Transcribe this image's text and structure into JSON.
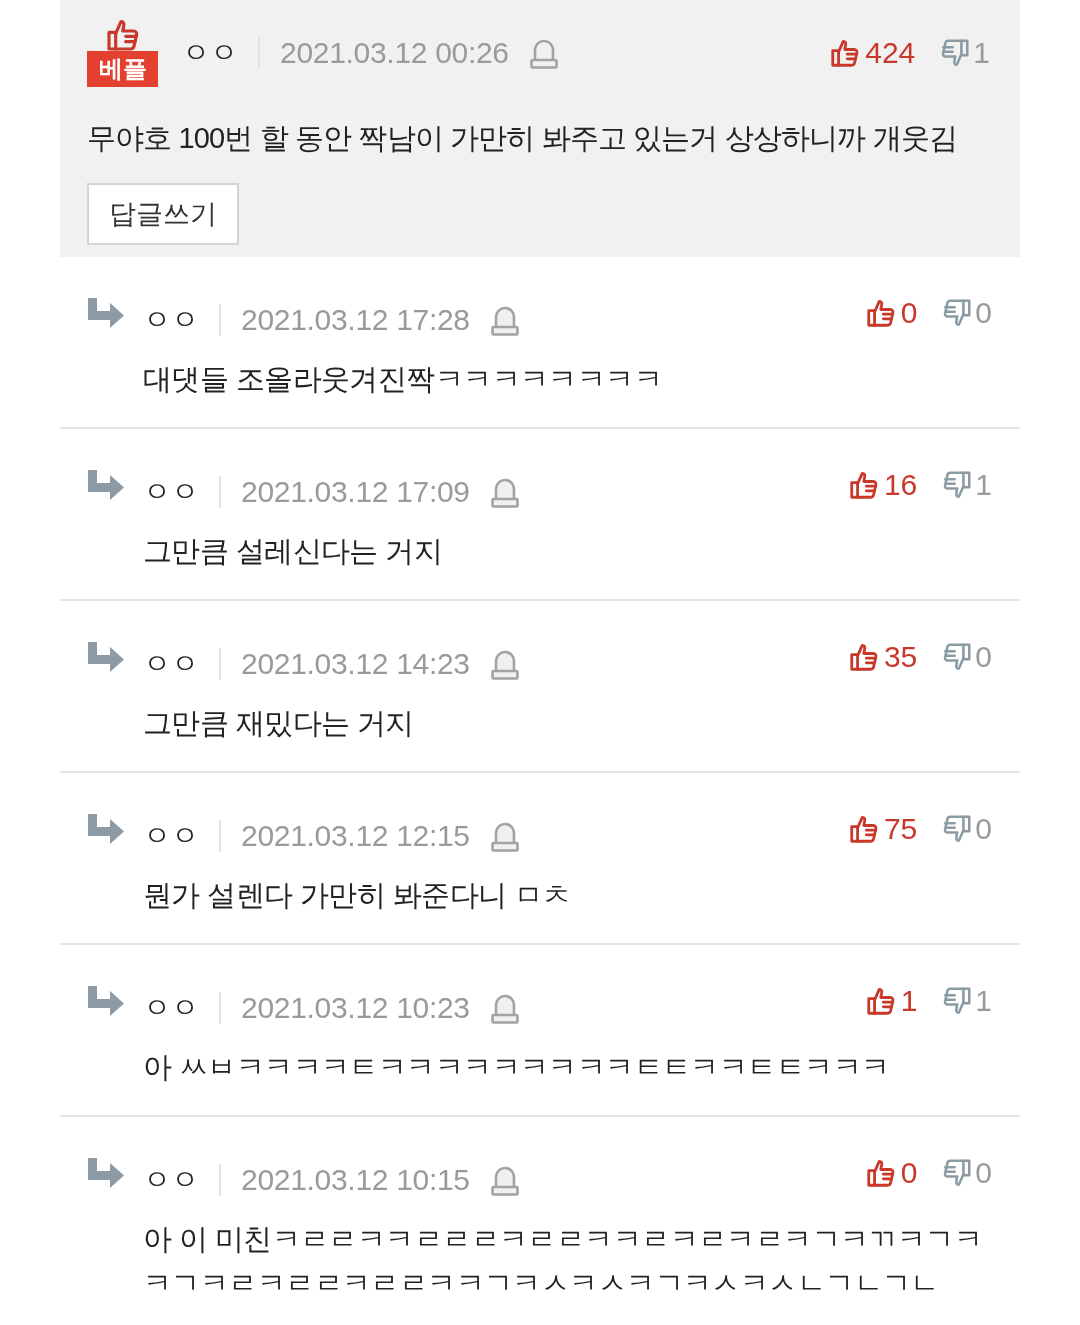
{
  "best_comment": {
    "badge": "베플",
    "author": "ㅇㅇ",
    "date": "2021.03.12 00:26",
    "likes": "424",
    "dislikes": "1",
    "text": "무야호 100번 할 동안 짝남이 가만히 봐주고 있는거 상상하니까 개웃김",
    "reply_button": "답글쓰기"
  },
  "replies": [
    {
      "author": "ㅇㅇ",
      "date": "2021.03.12 17:28",
      "likes": "0",
      "dislikes": "0",
      "text": "대댓들 조올라웃겨진짝ㅋㅋㅋㅋㅋㅋㅋㅋ"
    },
    {
      "author": "ㅇㅇ",
      "date": "2021.03.12 17:09",
      "likes": "16",
      "dislikes": "1",
      "text": "그만큼 설레신다는 거지"
    },
    {
      "author": "ㅇㅇ",
      "date": "2021.03.12 14:23",
      "likes": "35",
      "dislikes": "0",
      "text": "그만큼 재밌다는 거지"
    },
    {
      "author": "ㅇㅇ",
      "date": "2021.03.12 12:15",
      "likes": "75",
      "dislikes": "0",
      "text": "뭔가 설렌다 가만히 봐준다니 ㅁㅊ"
    },
    {
      "author": "ㅇㅇ",
      "date": "2021.03.12 10:23",
      "likes": "1",
      "dislikes": "1",
      "text": "아 ㅆㅂㅋㅋㅋㅋㅌㅋㅋㅋㅋㅋㅋㅋㅋㅋㅌㅌㅋㅋㅌㅌㅋㅋㅋ"
    },
    {
      "author": "ㅇㅇ",
      "date": "2021.03.12 10:15",
      "likes": "0",
      "dislikes": "0",
      "text": "아 이 미친ㅋㄹㄹㅋㅋㄹㄹㄹㅋㄹㄹㅋㅋㄹㅋㄹㅋㄹㅋㄱㅋㄲㅋㄱㅋㅋㄱㅋㄹㅋㄹㄹㅋㄹㄹㅋㅋㄱㅋㅅㅋㅅㅋㄱㅋㅅㅋㅅㄴㄱㄴㄱㄴ"
    }
  ]
}
